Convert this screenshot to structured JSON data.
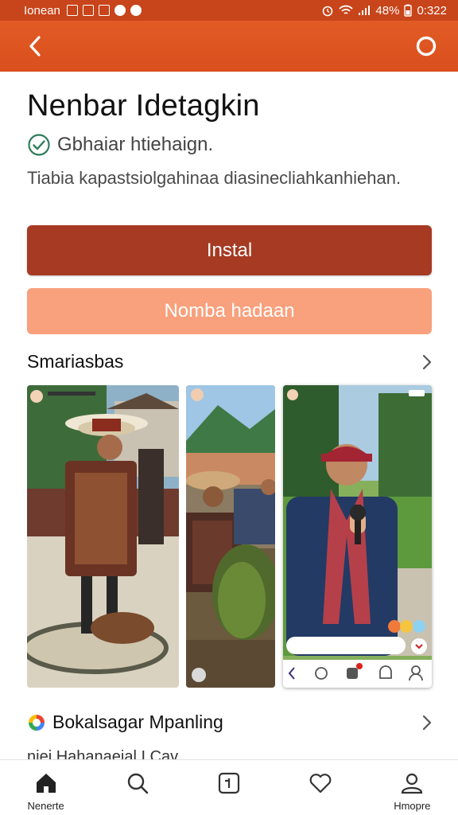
{
  "status_bar": {
    "carrier": "Ionean",
    "battery": "48%",
    "time": "0:322"
  },
  "app": {
    "title": "Nenbar Idetagkin",
    "verified_text": "Gbhaiar htiehaign.",
    "description": "Tiabia kapastsiolgahinaa diasinecliahkanhiehan."
  },
  "buttons": {
    "install": "Instal",
    "secondary": "Nomba hadaan"
  },
  "screenshots_section": {
    "title": "Smariasbas"
  },
  "similar_section": {
    "title": "Bokalsagar Mpanling",
    "partial": "niei Hahanaeial I Cav..."
  },
  "bottom_nav": {
    "items": [
      {
        "label": "Nenerte",
        "icon": "home-icon"
      },
      {
        "label": "",
        "icon": "search-icon"
      },
      {
        "label": "",
        "icon": "add-box-icon"
      },
      {
        "label": "",
        "icon": "heart-icon"
      },
      {
        "label": "Hmopre",
        "icon": "profile-icon"
      }
    ]
  },
  "colors": {
    "status_bar": "#c8441a",
    "app_bar": "#d94f1e",
    "install_button": "#a63a22",
    "secondary_button": "#f9a07c",
    "verified": "#2e7d5b"
  }
}
